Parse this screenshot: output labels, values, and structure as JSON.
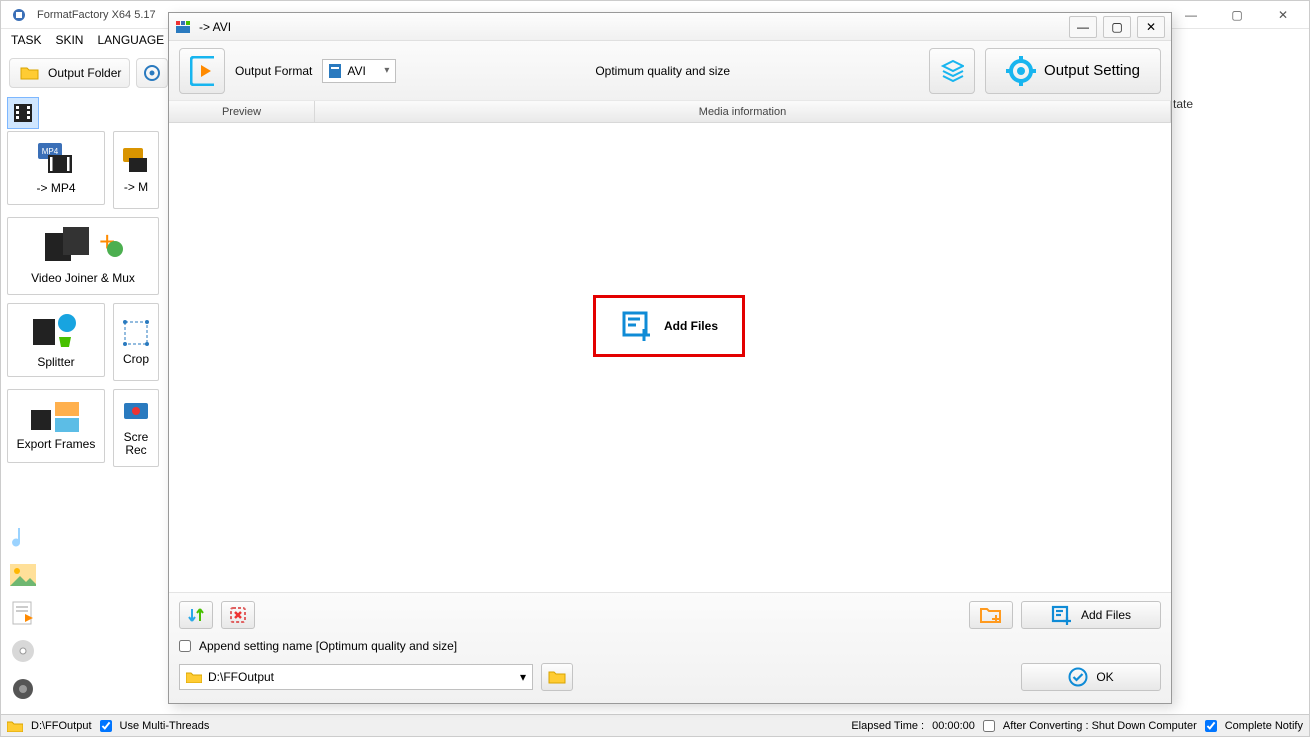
{
  "main_window": {
    "title": "FormatFactory X64 5.17",
    "menus": [
      "TASK",
      "SKIN",
      "LANGUAGE"
    ],
    "output_folder_label": "Output Folder",
    "right_header": "tate"
  },
  "tiles": {
    "mp4": "-> MP4",
    "m_half": "-> M",
    "joiner_mux": "Video Joiner & Mux",
    "splitter": "Splitter",
    "crop": "Crop",
    "export_frames": "Export Frames",
    "screen_rec": "Scre Rec"
  },
  "statusbar": {
    "output_path": "D:\\FFOutput",
    "multi_threads": "Use Multi-Threads",
    "elapsed_label": "Elapsed Time :",
    "elapsed_value": "00:00:00",
    "after_converting": "After Converting : Shut Down Computer",
    "complete_notify": "Complete Notify"
  },
  "dialog": {
    "title": "-> AVI",
    "output_format_label": "Output Format",
    "format_value": "AVI",
    "profile_text": "Optimum quality and size",
    "output_setting_label": "Output Setting",
    "col_preview": "Preview",
    "col_media": "Media information",
    "add_files_center": "Add Files",
    "append_setting_label": "Append setting name [Optimum quality and size]",
    "output_path": "D:\\FFOutput",
    "add_files_btn": "Add Files",
    "ok": "OK"
  }
}
